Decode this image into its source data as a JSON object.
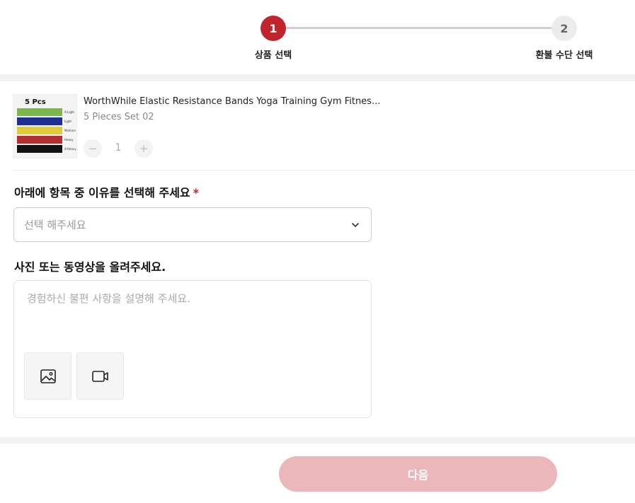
{
  "stepper": {
    "steps": [
      {
        "number": "1",
        "label": "상품 선택",
        "active": true
      },
      {
        "number": "2",
        "label": "환불 수단 선택",
        "active": false
      }
    ]
  },
  "product": {
    "thumbnail": {
      "title": "5 Pcs",
      "bands": [
        {
          "color": "#7ab648",
          "label": "X-Light"
        },
        {
          "color": "#1f2f8f",
          "label": "Light"
        },
        {
          "color": "#e0cc3a",
          "label": "Medium"
        },
        {
          "color": "#b3302c",
          "label": "Heavy"
        },
        {
          "color": "#111111",
          "label": "X-Heavy"
        }
      ]
    },
    "name": "WorthWhile Elastic Resistance Bands Yoga Training Gym Fitnes...",
    "variant": "5 Pieces Set 02",
    "quantity": "1",
    "minus_icon": "minus-icon",
    "plus_icon": "plus-icon"
  },
  "reason": {
    "label": "아래에 항목 중 이유를 선택해 주세요",
    "required_mark": "*",
    "placeholder": "선택 해주세요"
  },
  "upload": {
    "label": "사진 또는 동영상을 올려주세요.",
    "placeholder": "경험하신 불편 사항을 설명해 주세요.",
    "photo_icon": "image-icon",
    "video_icon": "video-icon"
  },
  "footer": {
    "next_label": "다음"
  },
  "colors": {
    "accent": "#c0252e",
    "next_disabled": "#ebb7bb"
  }
}
